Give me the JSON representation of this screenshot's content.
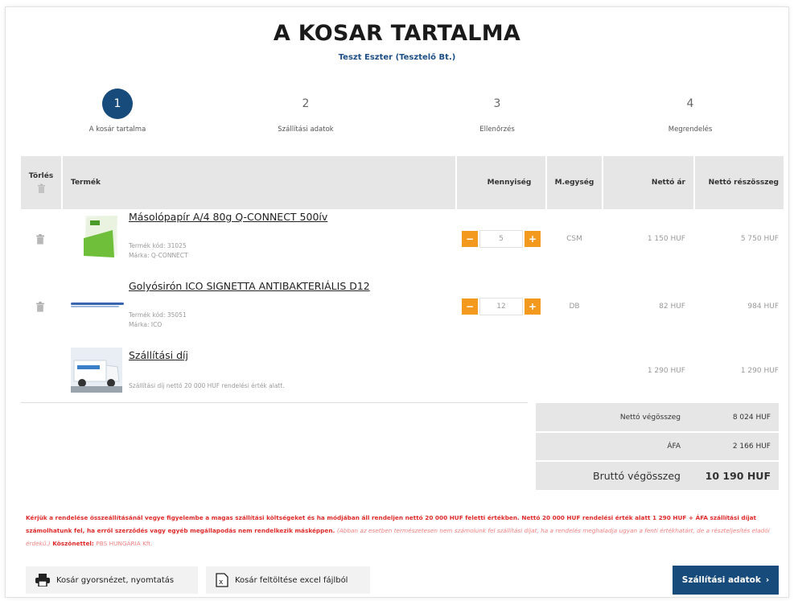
{
  "page": {
    "title": "A KOSAR TARTALMA",
    "customer": "Teszt Eszter (Tesztelő Bt.)"
  },
  "steps": [
    {
      "num": "1",
      "label": "A kosár tartalma",
      "active": true
    },
    {
      "num": "2",
      "label": "Szállítási adatok",
      "active": false
    },
    {
      "num": "3",
      "label": "Ellenőrzés",
      "active": false
    },
    {
      "num": "4",
      "label": "Megrendelés",
      "active": false
    }
  ],
  "table": {
    "headers": {
      "delete": "Törlés",
      "product": "Termék",
      "quantity": "Mennyiség",
      "unit": "M.egység",
      "net_price": "Nettó ár",
      "net_subtotal": "Nettó részösszeg"
    },
    "rows": [
      {
        "name": "Másolópapír A/4 80g Q-CONNECT 500ív",
        "code": "Termék kód: 31025",
        "brand": "Márka: Q-CONNECT",
        "quantity": "5",
        "unit": "CSM",
        "net_price": "1 150 HUF",
        "subtotal": "5 750 HUF"
      },
      {
        "name": "Golyósirón ICO SIGNETTA ANTIBAKTERIÁLIS D12",
        "code": "Termék kód: 35051",
        "brand": "Márka: ICO",
        "quantity": "12",
        "unit": "DB",
        "net_price": "82 HUF",
        "subtotal": "984 HUF"
      }
    ],
    "shipping": {
      "name": "Szállítási díj",
      "note": "Szállítási díj nettó 20 000 HUF rendelési érték alatt.",
      "net_price": "1 290 HUF",
      "subtotal": "1 290 HUF"
    },
    "qty_minus": "−",
    "qty_plus": "+"
  },
  "totals": {
    "net_label": "Nettó végösszeg",
    "net_value": "8 024 HUF",
    "vat_label": "ÁFA",
    "vat_value": "2 166 HUF",
    "gross_label": "Bruttó végösszeg",
    "gross_value": "10 190 HUF"
  },
  "notice": {
    "main": "Kérjük a rendelése összeállításánál vegye figyelembe a magas szállítási költségeket és ha módjában áll rendeljen nettó 20 000 HUF feletti értékben. Nettó 20 000 HUF rendelési érték alatt 1 290 HUF + ÁFA szállítási díjat számolhatunk fel, ha erről szerződés vagy egyéb megállapodás nem rendelkezik másképpen.",
    "aside": "(Abban az esetben természetesen nem számolunk fel szállítási díjat, ha a rendelés meghaladja ugyan a fenti értékhatárt, de a részteljesítés eladói érdekű.)",
    "thanks": "Köszönettel:",
    "company": "PBS HUNGÁRIA Kft."
  },
  "buttons": {
    "print": "Kosár gyorsnézet, nyomtatás",
    "excel": "Kosár feltöltése excel fájlból",
    "next": "Szállítási adatok",
    "next_arrow": "›"
  },
  "colors": {
    "primary": "#174b7c",
    "accent": "#f39a1e",
    "warning": "#e02a2a"
  }
}
